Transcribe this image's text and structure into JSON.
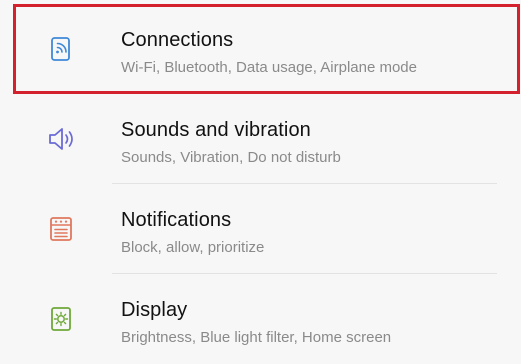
{
  "settings": {
    "items": [
      {
        "title": "Connections",
        "subtitle": "Wi-Fi, Bluetooth, Data usage, Airplane mode",
        "icon": "connections-icon",
        "icon_color": "#3f88d8"
      },
      {
        "title": "Sounds and vibration",
        "subtitle": "Sounds, Vibration, Do not disturb",
        "icon": "speaker-icon",
        "icon_color": "#6b6bd6"
      },
      {
        "title": "Notifications",
        "subtitle": "Block, allow, prioritize",
        "icon": "notifications-icon",
        "icon_color": "#e0785e"
      },
      {
        "title": "Display",
        "subtitle": "Brightness, Blue light filter, Home screen",
        "icon": "display-brightness-icon",
        "icon_color": "#6fa83a"
      }
    ]
  },
  "highlight": {
    "target": "Connections",
    "color": "#d3222d"
  }
}
